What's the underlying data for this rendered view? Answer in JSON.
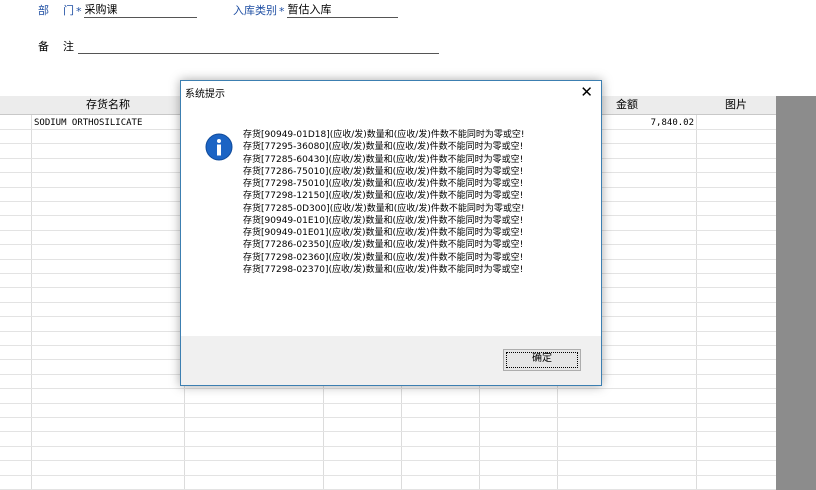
{
  "form": {
    "dept_label": "部    门",
    "dept_req": "*",
    "dept_value": "采购课",
    "type_label": "入库类别",
    "type_req": "*",
    "type_value": "暂估入库",
    "note_label": "备    注",
    "note_value": ""
  },
  "grid": {
    "headers": [
      "存货名称",
      "金额",
      "图片"
    ],
    "rows": [
      {
        "name": "SODIUM ORTHOSILICATE",
        "amount": "7,840.02"
      }
    ]
  },
  "dialog": {
    "title": "系统提示",
    "close_glyph": "✕",
    "messages": [
      "存货[90949-01D18](应收/发)数量和(应收/发)件数不能同时为零或空!",
      "存货[77295-36080](应收/发)数量和(应收/发)件数不能同时为零或空!",
      "存货[77285-60430](应收/发)数量和(应收/发)件数不能同时为零或空!",
      "存货[77286-75010](应收/发)数量和(应收/发)件数不能同时为零或空!",
      "存货[77298-75010](应收/发)数量和(应收/发)件数不能同时为零或空!",
      "存货[77298-12150](应收/发)数量和(应收/发)件数不能同时为零或空!",
      "存货[77285-0D300](应收/发)数量和(应收/发)件数不能同时为零或空!",
      "存货[90949-01E10](应收/发)数量和(应收/发)件数不能同时为零或空!",
      "存货[90949-01E01](应收/发)数量和(应收/发)件数不能同时为零或空!",
      "存货[77286-02350](应收/发)数量和(应收/发)件数不能同时为零或空!",
      "存货[77298-02360](应收/发)数量和(应收/发)件数不能同时为零或空!",
      "存货[77298-02370](应收/发)数量和(应收/发)件数不能同时为零或空!"
    ],
    "ok_label": "确定",
    "icon": "info-icon"
  },
  "colors": {
    "label_blue": "#1f4fa3",
    "dialog_border": "#3c7fb1",
    "info_blue": "#1c64c4"
  }
}
